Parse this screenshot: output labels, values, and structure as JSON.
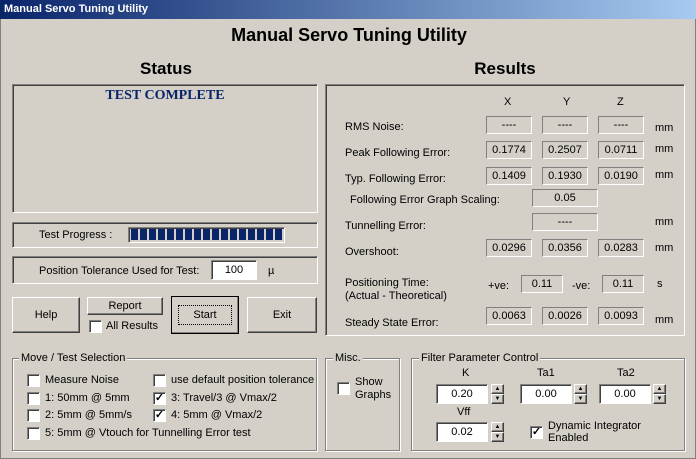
{
  "window": {
    "title": "Manual Servo Tuning Utility"
  },
  "app_title": "Manual Servo Tuning Utility",
  "status": {
    "heading": "Status",
    "message": "TEST COMPLETE",
    "progress_label": "Test Progress :",
    "progress_segments": 17,
    "tolerance_label": "Position Tolerance Used for Test:",
    "tolerance_value": "100",
    "tolerance_unit": "µ"
  },
  "buttons": {
    "help": "Help",
    "report": "Report",
    "all_results": "All Results",
    "start": "Start",
    "exit": "Exit"
  },
  "results": {
    "heading": "Results",
    "col_x": "X",
    "col_y": "Y",
    "col_z": "Z",
    "rms_noise": {
      "label": "RMS Noise:",
      "x": "----",
      "y": "----",
      "z": "----",
      "unit": "mm"
    },
    "peak": {
      "label": "Peak Following Error:",
      "x": "0.1774",
      "y": "0.2507",
      "z": "0.0711",
      "unit": "mm"
    },
    "typ": {
      "label": "Typ. Following Error:",
      "x": "0.1409",
      "y": "0.1930",
      "z": "0.0190",
      "unit": "mm"
    },
    "scaling": {
      "label": "Following Error Graph Scaling:",
      "value": "0.05"
    },
    "tunnelling": {
      "label": "Tunnelling Error:",
      "value": "----",
      "unit": "mm"
    },
    "overshoot": {
      "label": "Overshoot:",
      "x": "0.0296",
      "y": "0.0356",
      "z": "0.0283",
      "unit": "mm"
    },
    "positioning": {
      "label1": "Positioning Time:",
      "label2": "(Actual - Theoretical)",
      "pos_label": "+ve:",
      "pos": "0.11",
      "neg_label": "-ve:",
      "neg": "0.11",
      "unit": "s"
    },
    "steady": {
      "label": "Steady State Error:",
      "x": "0.0063",
      "y": "0.0026",
      "z": "0.0093",
      "unit": "mm"
    }
  },
  "move_selection": {
    "title": "Move / Test Selection",
    "measure_noise": {
      "label": "Measure Noise",
      "checked": false
    },
    "opt1": {
      "label": "1: 50mm @ 5mm",
      "checked": false
    },
    "opt2": {
      "label": "2: 5mm @ 5mm/s",
      "checked": false
    },
    "opt5": {
      "label": "5: 5mm @ Vtouch for Tunnelling Error test",
      "checked": false
    },
    "default_tol": {
      "label": "use default position tolerance",
      "checked": false
    },
    "opt3": {
      "label": "3: Travel/3 @ Vmax/2",
      "checked": true
    },
    "opt4": {
      "label": "4: 5mm @ Vmax/2",
      "checked": true
    }
  },
  "misc": {
    "title": "Misc.",
    "show_graphs": {
      "label1": "Show",
      "label2": "Graphs",
      "checked": false
    }
  },
  "filter": {
    "title": "Filter Parameter Control",
    "k": {
      "label": "K",
      "value": "0.20"
    },
    "ta1": {
      "label": "Ta1",
      "value": "0.00"
    },
    "ta2": {
      "label": "Ta2",
      "value": "0.00"
    },
    "vff": {
      "label": "Vff",
      "value": "0.02"
    },
    "dynamic": {
      "label1": "Dynamic Integrator",
      "label2": "Enabled",
      "checked": true
    }
  }
}
